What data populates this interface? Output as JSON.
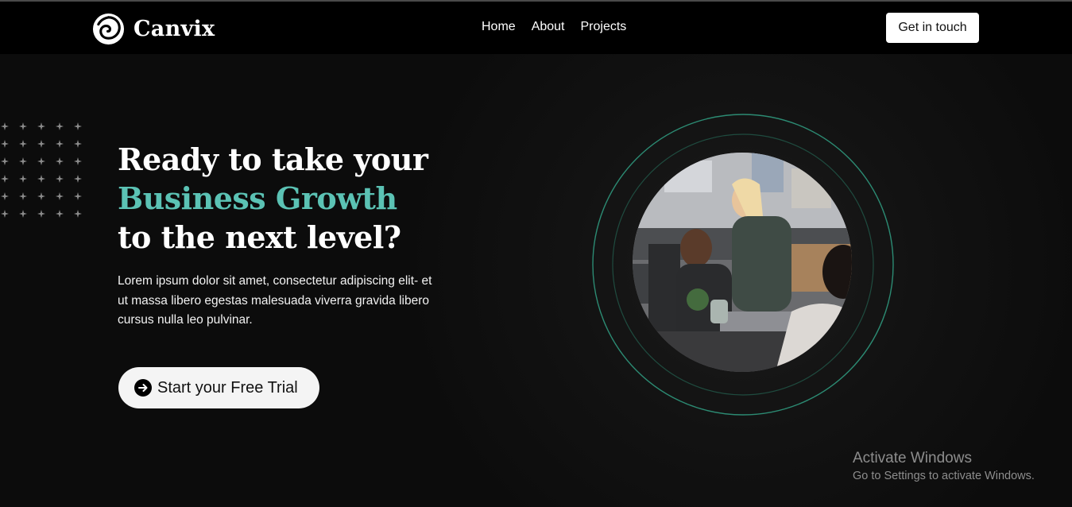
{
  "brand": {
    "name": "Canvix",
    "logo_icon": "swirl-logo-icon"
  },
  "nav": {
    "items": [
      {
        "label": "Home"
      },
      {
        "label": "About"
      },
      {
        "label": "Projects"
      }
    ],
    "cta_label": "Get in touch"
  },
  "hero": {
    "headline_line1": "Ready to take your",
    "headline_accent": "Business Growth",
    "headline_line3": "to the next level?",
    "paragraph": "Lorem ipsum dolor sit amet, consectetur adipiscing elit- et ut massa libero egestas malesuada viverra gravida libero cursus nulla leo pulvinar.",
    "cta_label": "Start your Free Trial",
    "cta_icon": "arrow-right-circle-icon",
    "decor_icon": "sparkle-grid-icon",
    "image_icon": "team-photo"
  },
  "watermark": {
    "title": "Activate Windows",
    "subtitle": "Go to Settings to activate Windows."
  },
  "colors": {
    "background": "#0c0c0c",
    "navbar": "#000000",
    "accent": "#5bc2b4",
    "ring": "#2c8b73",
    "button_bg": "#f4f4f4"
  }
}
